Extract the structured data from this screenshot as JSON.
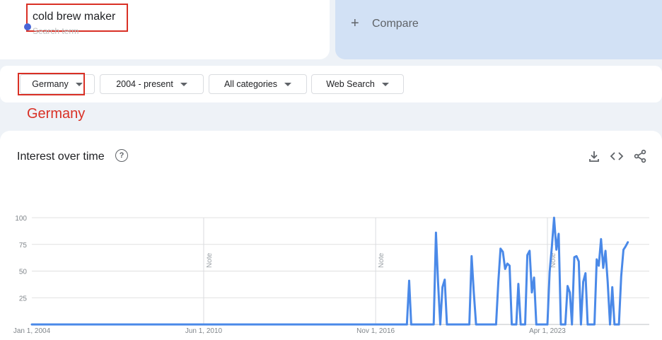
{
  "search": {
    "term": "cold brew maker",
    "subtitle": "Search term",
    "term_color": "#4a66d6"
  },
  "compare": {
    "plus": "+",
    "label": "Compare"
  },
  "filters": {
    "region": "Germany",
    "time_range": "2004 - present",
    "category": "All categories",
    "property": "Web Search"
  },
  "annotation": {
    "text": "Germany",
    "color": "#d93025"
  },
  "chart": {
    "title": "Interest over time",
    "help_icon": "?",
    "icons": [
      "download-icon",
      "embed-icon",
      "share-icon"
    ]
  },
  "chart_data": {
    "type": "line",
    "x_range": [
      "2004-01-01",
      "2024-08-01"
    ],
    "ylim": [
      0,
      100
    ],
    "yticks": [
      25,
      50,
      75,
      100
    ],
    "xticks": [
      {
        "label": "Jan 1, 2004",
        "date": "2004-01-01"
      },
      {
        "label": "Jun 1, 2010",
        "date": "2010-06-01"
      },
      {
        "label": "Nov 1, 2016",
        "date": "2016-11-01"
      },
      {
        "label": "Apr 1, 2023",
        "date": "2023-04-01"
      }
    ],
    "notes": [
      {
        "label": "Note",
        "date": "2010-06-01"
      },
      {
        "label": "Note",
        "date": "2016-11-01"
      },
      {
        "label": "Note",
        "date": "2023-04-01"
      }
    ],
    "grid": true,
    "series": [
      {
        "color": "#4a89e8",
        "points": [
          [
            "2004-01-01",
            0
          ],
          [
            "2018-01-01",
            0
          ],
          [
            "2018-02-01",
            41
          ],
          [
            "2018-03-01",
            0
          ],
          [
            "2019-01-01",
            0
          ],
          [
            "2019-02-01",
            86
          ],
          [
            "2019-03-01",
            40
          ],
          [
            "2019-04-01",
            0
          ],
          [
            "2019-05-01",
            35
          ],
          [
            "2019-06-01",
            42
          ],
          [
            "2019-07-01",
            0
          ],
          [
            "2020-05-01",
            0
          ],
          [
            "2020-06-01",
            64
          ],
          [
            "2020-07-01",
            30
          ],
          [
            "2020-08-01",
            0
          ],
          [
            "2021-05-01",
            0
          ],
          [
            "2021-06-01",
            40
          ],
          [
            "2021-07-01",
            71
          ],
          [
            "2021-08-01",
            68
          ],
          [
            "2021-09-01",
            52
          ],
          [
            "2021-10-01",
            57
          ],
          [
            "2021-11-01",
            55
          ],
          [
            "2021-12-01",
            0
          ],
          [
            "2022-02-01",
            0
          ],
          [
            "2022-03-01",
            38
          ],
          [
            "2022-04-01",
            0
          ],
          [
            "2022-06-01",
            0
          ],
          [
            "2022-07-01",
            65
          ],
          [
            "2022-08-01",
            69
          ],
          [
            "2022-09-01",
            30
          ],
          [
            "2022-10-01",
            44
          ],
          [
            "2022-11-01",
            0
          ],
          [
            "2023-04-01",
            0
          ],
          [
            "2023-05-01",
            49
          ],
          [
            "2023-06-01",
            73
          ],
          [
            "2023-07-01",
            100
          ],
          [
            "2023-08-01",
            70
          ],
          [
            "2023-09-01",
            85
          ],
          [
            "2023-10-01",
            0
          ],
          [
            "2023-12-01",
            0
          ],
          [
            "2024-01-01",
            36
          ],
          [
            "2024-02-01",
            30
          ],
          [
            "2024-03-01",
            0
          ],
          [
            "2024-04-01",
            63
          ],
          [
            "2024-05-01",
            64
          ],
          [
            "2024-06-01",
            59
          ],
          [
            "2024-07-01",
            0
          ],
          [
            "2024-08-01",
            40
          ],
          [
            "2024-09-01",
            48
          ],
          [
            "2024-10-01",
            0
          ],
          [
            "2025-01-01",
            0
          ],
          [
            "2025-02-01",
            61
          ],
          [
            "2025-03-01",
            55
          ],
          [
            "2025-04-01",
            80
          ],
          [
            "2025-05-01",
            53
          ],
          [
            "2025-06-01",
            69
          ],
          [
            "2025-07-01",
            40
          ],
          [
            "2025-08-01",
            0
          ],
          [
            "2025-09-01",
            35
          ],
          [
            "2025-10-01",
            0
          ],
          [
            "2025-12-01",
            0
          ],
          [
            "2026-01-01",
            45
          ],
          [
            "2026-02-01",
            70
          ],
          [
            "2026-03-01",
            73
          ],
          [
            "2026-04-01",
            77
          ]
        ]
      }
    ]
  }
}
